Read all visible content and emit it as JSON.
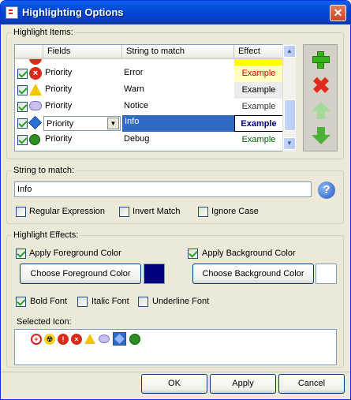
{
  "window": {
    "title": "Highlighting Options",
    "close_glyph": "✕"
  },
  "highlight_items": {
    "group_label": "Highlight Items:",
    "columns": [
      "Fields",
      "String to match",
      "Effect"
    ],
    "rows": [
      {
        "checked": true,
        "icon": "error-icon",
        "field": "Priority",
        "match": "Error",
        "effect": "Example",
        "fg": "#d40000",
        "bg": "#ffffc0"
      },
      {
        "checked": true,
        "icon": "warning-icon",
        "field": "Priority",
        "match": "Warn",
        "effect": "Example",
        "fg": "#000000",
        "bg": "#ececec"
      },
      {
        "checked": true,
        "icon": "notice-bubble-icon",
        "field": "Priority",
        "match": "Notice",
        "effect": "Example",
        "fg": "#333333",
        "bg": "#ffffff"
      },
      {
        "checked": true,
        "icon": "info-icon",
        "field": "Priority",
        "match": "Info",
        "effect": "Example",
        "fg": "#000080",
        "bg": "#ffffff"
      },
      {
        "checked": true,
        "icon": "debug-bug-icon",
        "field": "Priority",
        "match": "Debug",
        "effect": "Example",
        "fg": "#006400",
        "bg": "#ffffff"
      }
    ]
  },
  "string_to_match": {
    "group_label": "String to match:",
    "value": "Info",
    "regex_label": "Regular Expression",
    "regex_checked": false,
    "invert_label": "Invert Match",
    "invert_checked": false,
    "ignore_case_label": "Ignore Case",
    "ignore_case_checked": false,
    "help_glyph": "?"
  },
  "effects": {
    "group_label": "Highlight Effects:",
    "apply_fg_label": "Apply Foreground Color",
    "apply_fg_checked": true,
    "apply_bg_label": "Apply Background Color",
    "apply_bg_checked": true,
    "choose_fg_label": "Choose Foreground Color",
    "fg_color": "#000080",
    "choose_bg_label": "Choose Background Color",
    "bg_color": "#ffffff",
    "bold_label": "Bold Font",
    "bold_checked": true,
    "italic_label": "Italic Font",
    "italic_checked": false,
    "underline_label": "Underline Font",
    "underline_checked": false,
    "selected_icon_label": "Selected Icon:"
  },
  "icon_choices": [
    "plus-circle-icon",
    "radiation-icon",
    "error-exclamation-icon",
    "error-x-icon",
    "warning-icon",
    "notice-bubble-icon",
    "info-icon",
    "debug-bug-icon"
  ],
  "footer": {
    "ok": "OK",
    "apply": "Apply",
    "cancel": "Cancel"
  }
}
